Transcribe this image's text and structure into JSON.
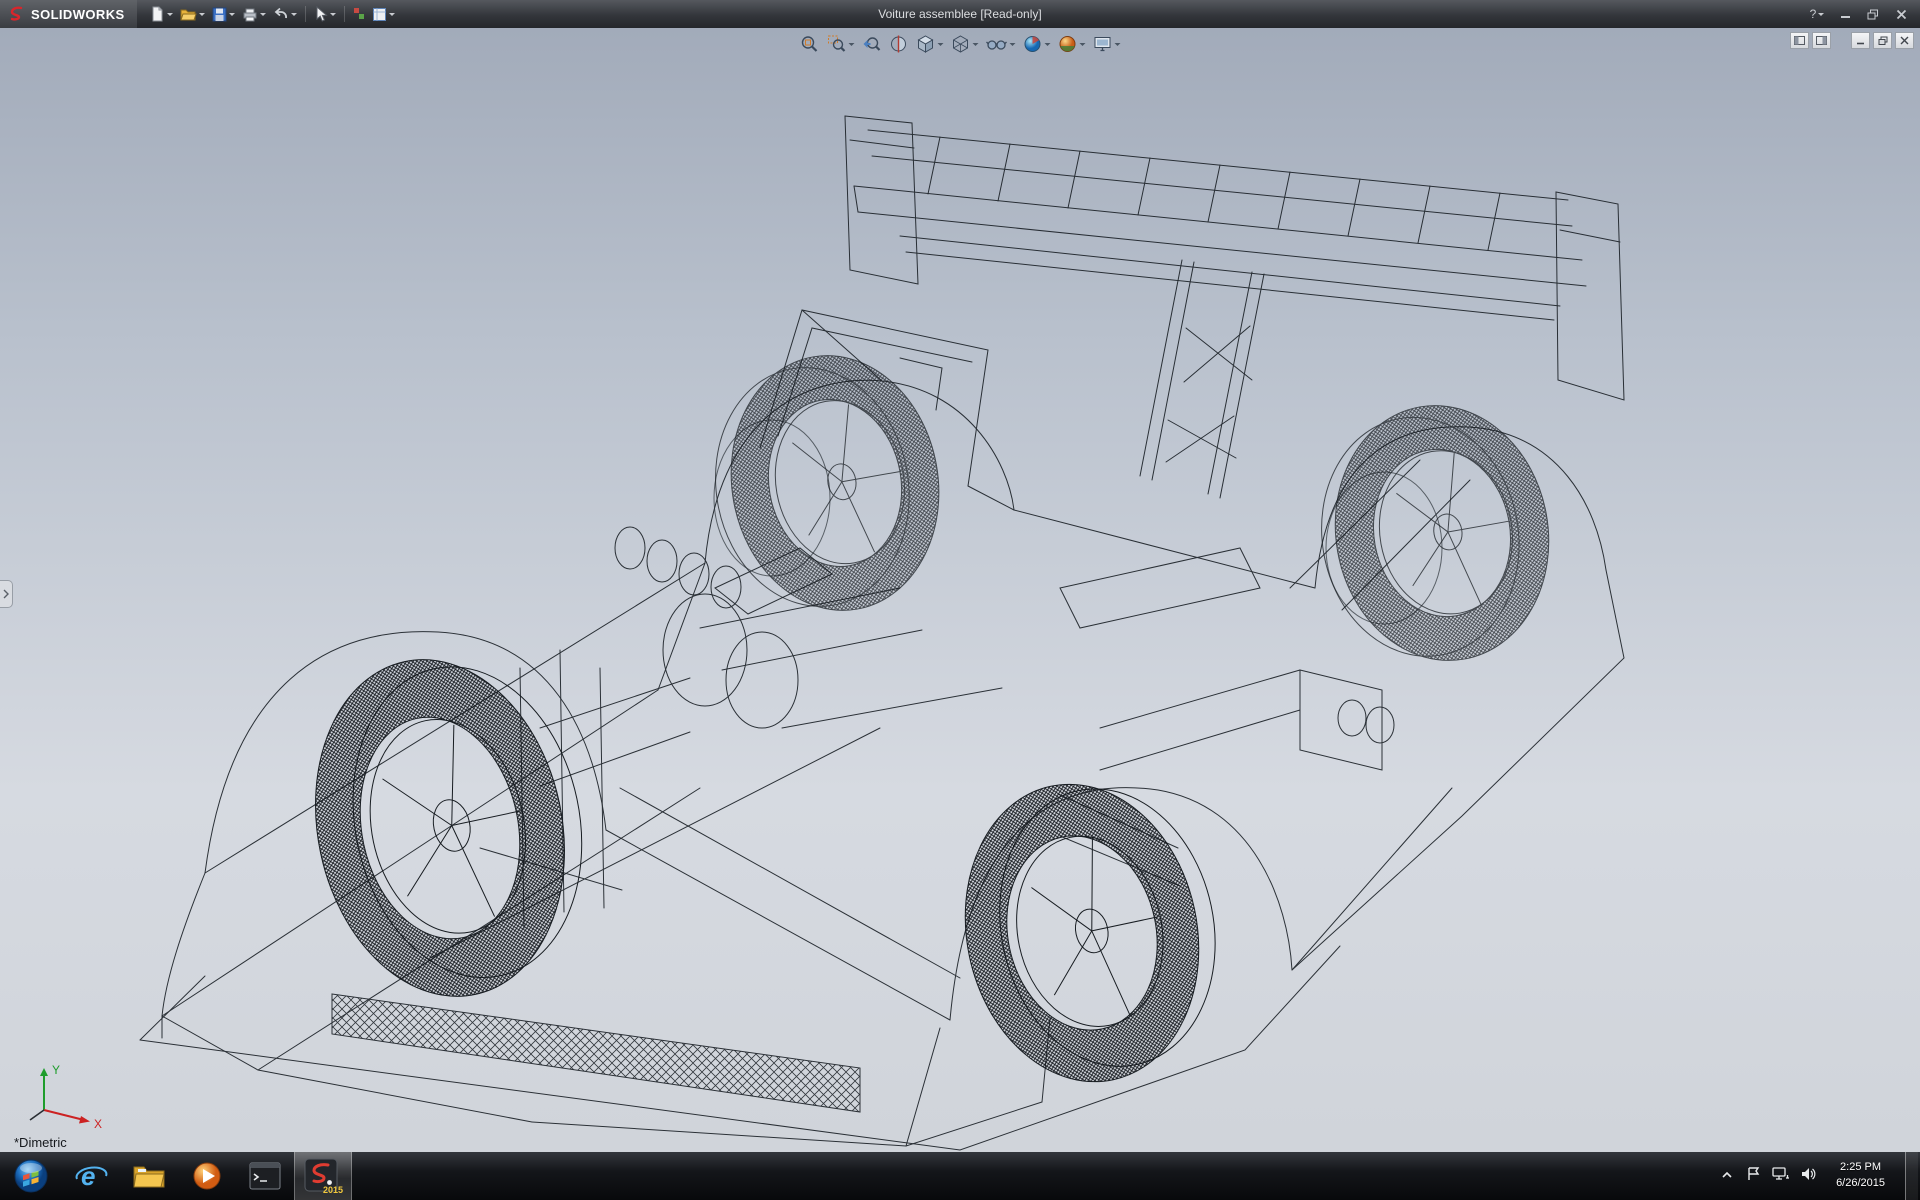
{
  "titlebar": {
    "app_name": "SOLIDWORKS",
    "document_title": "Voiture assemblee [Read-only]",
    "help_glyph": "?",
    "toolbar_icons": [
      "new-document",
      "open",
      "save",
      "print",
      "undo",
      "select-arrow",
      "macro",
      "sheet-format",
      "options"
    ],
    "window_controls": [
      "help",
      "minimize",
      "restore",
      "close"
    ]
  },
  "heads_up_toolbar": {
    "icons": [
      "zoom-to-fit",
      "zoom-to-area",
      "previous-view",
      "section-view",
      "view-orientation",
      "display-style",
      "hide-show-items",
      "edit-appearance",
      "apply-scene",
      "view-settings"
    ]
  },
  "document_window_controls": [
    "feature-pane-left",
    "feature-pane-right",
    "minimize-document",
    "restore-document",
    "close-document"
  ],
  "viewport": {
    "orientation_label": "*Dimetric",
    "triad": {
      "x_label": "X",
      "y_label": "Y"
    },
    "model": "wireframe race car assembly"
  },
  "taskbar": {
    "items": [
      {
        "name": "start"
      },
      {
        "name": "internet-explorer",
        "glyph": "e"
      },
      {
        "name": "windows-explorer"
      },
      {
        "name": "media-player"
      },
      {
        "name": "command-prompt"
      },
      {
        "name": "solidworks-2015",
        "badge": "2015",
        "active": true
      }
    ],
    "tray": {
      "time": "2:25 PM",
      "date": "6/26/2015"
    }
  },
  "colors": {
    "brand_red": "#d8262c",
    "viewport_gradient_top": "#a2abba",
    "viewport_gradient_bottom": "#d0d4da",
    "wireframe": "#1d2329"
  }
}
